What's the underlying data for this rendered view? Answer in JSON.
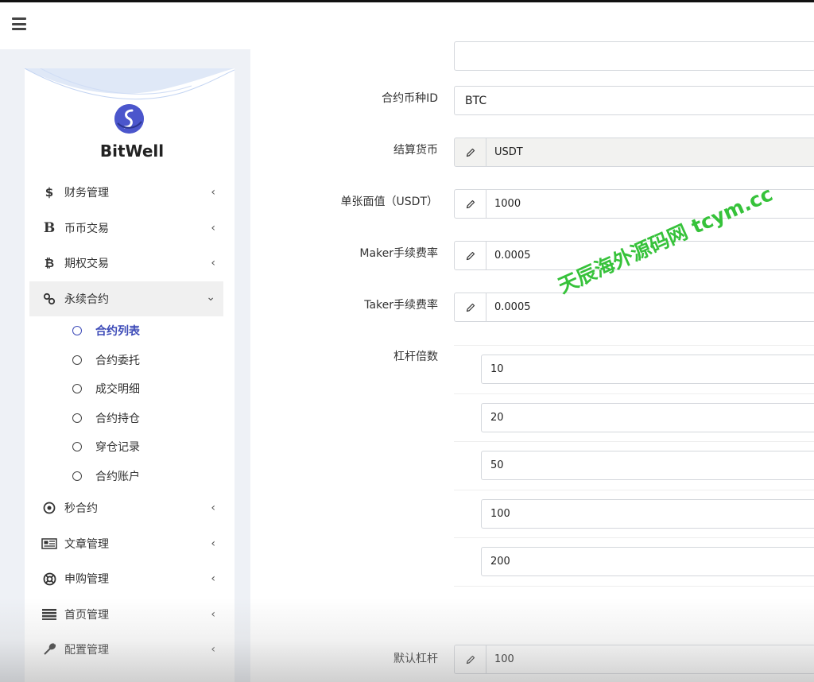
{
  "app": {
    "logo_text": "BitWell"
  },
  "watermark": "天辰海外源码网 tcym.cc",
  "sidebar": {
    "items": [
      {
        "label": "财务管理",
        "icon": "dollar-icon"
      },
      {
        "label": "币币交易",
        "icon": "bitcoin-b-icon"
      },
      {
        "label": "期权交易",
        "icon": "bitcoin-icon"
      },
      {
        "label": "永续合约",
        "icon": "link-icon",
        "expanded": true,
        "children": [
          {
            "label": "合约列表",
            "active": true
          },
          {
            "label": "合约委托"
          },
          {
            "label": "成交明细"
          },
          {
            "label": "合约持仓"
          },
          {
            "label": "穿仓记录"
          },
          {
            "label": "合约账户"
          }
        ]
      },
      {
        "label": "秒合约",
        "icon": "dot-circle-icon"
      },
      {
        "label": "文章管理",
        "icon": "newspaper-icon"
      },
      {
        "label": "申购管理",
        "icon": "lifebuoy-icon"
      },
      {
        "label": "首页管理",
        "icon": "list-icon"
      },
      {
        "label": "配置管理",
        "icon": "wrench-icon"
      }
    ]
  },
  "form": {
    "contract_id": {
      "label": "合约币种ID",
      "value": "BTC"
    },
    "settle_currency": {
      "label": "结算货币",
      "value": "USDT"
    },
    "face_value": {
      "label": "单张面值（USDT）",
      "value": "1000"
    },
    "maker_fee": {
      "label": "Maker手续费率",
      "value": "0.0005"
    },
    "taker_fee": {
      "label": "Taker手续费率",
      "value": "0.0005"
    },
    "leverage": {
      "label": "杠杆倍数",
      "values": [
        "10",
        "20",
        "50",
        "100",
        "200"
      ]
    },
    "default_leverage": {
      "label": "默认杠杆",
      "value": "100"
    }
  },
  "colors": {
    "accent": "#3d4bb8",
    "watermark": "#36c23a"
  }
}
